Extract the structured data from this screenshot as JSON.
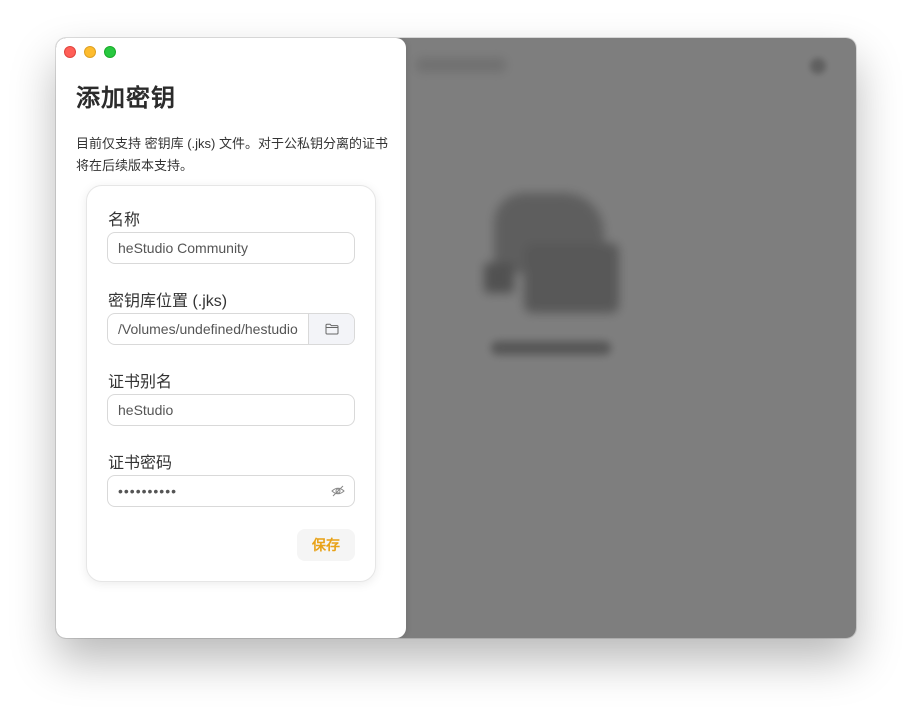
{
  "sheet": {
    "title": "添加密钥",
    "description": "目前仅支持 密钥库 (.jks) 文件。对于公私钥分离的证书将在后续版本支持。"
  },
  "form": {
    "name": {
      "label": "名称",
      "value": "heStudio Community"
    },
    "keystore": {
      "label": "密钥库位置 (.jks)",
      "value": "/Volumes/undefined/hestudio",
      "browse_icon": "folder-icon"
    },
    "alias": {
      "label": "证书别名",
      "value": "heStudio"
    },
    "password": {
      "label": "证书密码",
      "value": "••••••••••",
      "toggle_icon": "eye-off-icon"
    },
    "save_label": "保存"
  },
  "colors": {
    "accent": "#e8a218",
    "close": "#ff5f57",
    "minimize": "#febc2e",
    "maximize": "#28c840"
  }
}
